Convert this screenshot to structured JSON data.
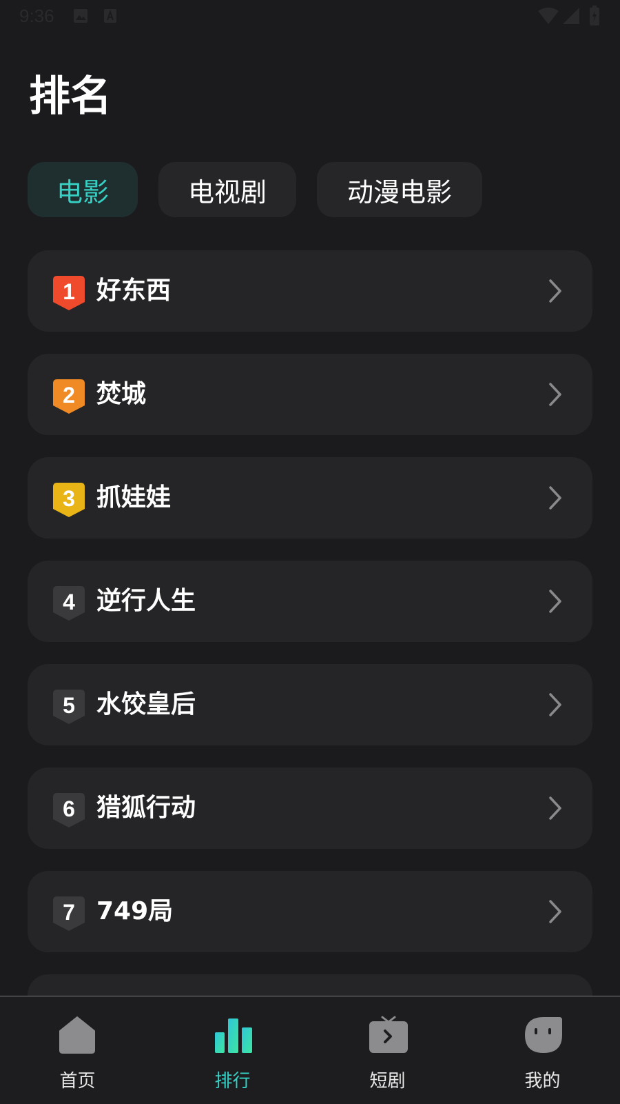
{
  "status_bar": {
    "time": "9:36"
  },
  "page": {
    "title": "排名"
  },
  "tabs": [
    {
      "label": "电影",
      "active": true
    },
    {
      "label": "电视剧",
      "active": false
    },
    {
      "label": "动漫电影",
      "active": false
    }
  ],
  "ranking": [
    {
      "rank": "1",
      "title": "好东西",
      "badge_color": "#ee4a2b"
    },
    {
      "rank": "2",
      "title": "焚城",
      "badge_color": "#ef8a24"
    },
    {
      "rank": "3",
      "title": "抓娃娃",
      "badge_color": "#e9b416"
    },
    {
      "rank": "4",
      "title": "逆行人生",
      "badge_color": "#3a3a3d"
    },
    {
      "rank": "5",
      "title": "水饺皇后",
      "badge_color": "#3a3a3d"
    },
    {
      "rank": "6",
      "title": "猎狐行动",
      "badge_color": "#3a3a3d"
    },
    {
      "rank": "7",
      "title": "749局",
      "badge_color": "#3a3a3d"
    }
  ],
  "bottom_nav": [
    {
      "label": "首页",
      "icon": "home-icon",
      "active": false
    },
    {
      "label": "排行",
      "icon": "ranking-icon",
      "active": true
    },
    {
      "label": "短剧",
      "icon": "tv-icon",
      "active": false
    },
    {
      "label": "我的",
      "icon": "profile-icon",
      "active": false
    }
  ],
  "colors": {
    "accent": "#37d0c4",
    "background": "#1b1b1d",
    "card": "#252528"
  }
}
